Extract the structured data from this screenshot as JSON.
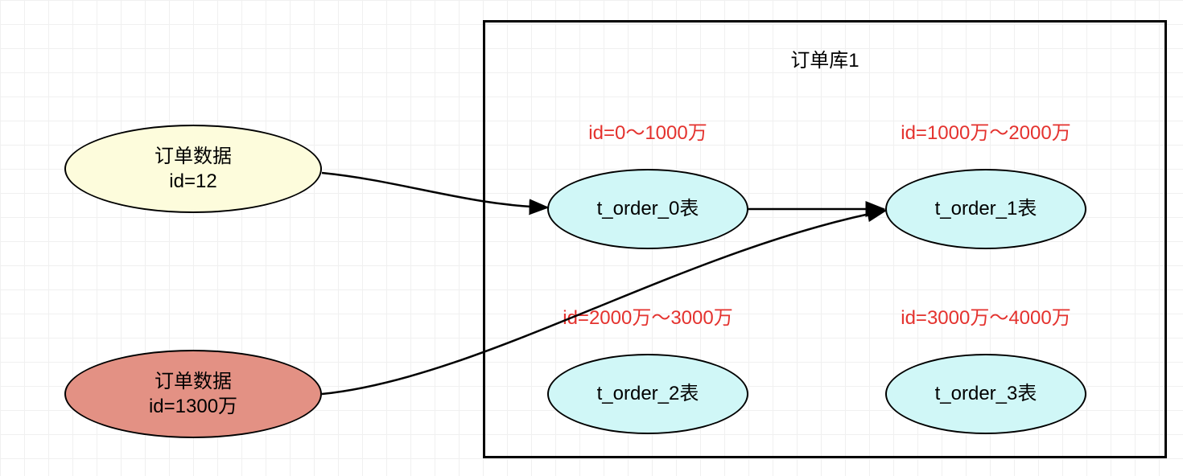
{
  "source1": {
    "line1": "订单数据",
    "line2": "id=12"
  },
  "source2": {
    "line1": "订单数据",
    "line2": "id=1300万"
  },
  "db": {
    "title": "订单库1"
  },
  "ranges": {
    "r0": "id=0～1000万",
    "r1": "id=1000万～2000万",
    "r2": "id=2000万～3000万",
    "r3": "id=3000万～4000万"
  },
  "tables": {
    "t0": "t_order_0表",
    "t1": "t_order_1表",
    "t2": "t_order_2表",
    "t3": "t_order_3表"
  }
}
